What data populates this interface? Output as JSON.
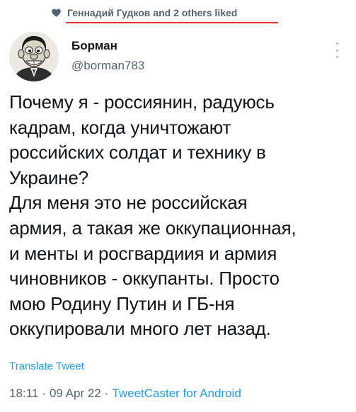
{
  "social_context": {
    "icon": "heart-icon",
    "text": "Геннадий Гудков and 2 others liked",
    "underline_color": "#e0302a"
  },
  "author": {
    "name": "Борман",
    "handle": "@borman783",
    "avatar_icon": "avatar-caricature"
  },
  "tweet": {
    "text": "Почему я - россиянин, радуюсь\nкадрам, когда уничтожают\nроссийских солдат и технику в\nУкраине?\nДля меня это не российская\nармия, а такая же оккупационная,\nи менты и росгвардиия и армия\nчиновников - оккупанты. Просто\nмою Родину Путин и ГБ-ня\nоккупировали много лет назад.",
    "translate_label": "Translate Tweet"
  },
  "meta": {
    "time": "18:11",
    "sep1": "·",
    "date": "09 Apr 22",
    "sep2": "·",
    "client": "TweetCaster for Android"
  },
  "colors": {
    "link": "#1d9bf0",
    "secondary_text": "#536471",
    "primary_text": "#0f1419"
  }
}
